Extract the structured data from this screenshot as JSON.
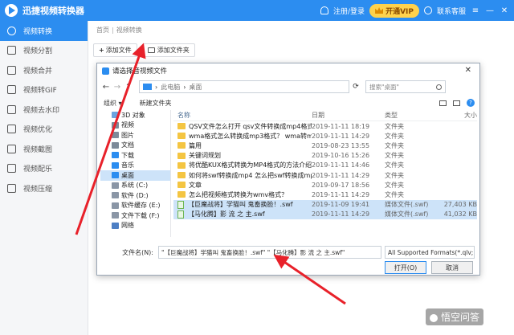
{
  "app": {
    "title": "迅捷视频转换器"
  },
  "titlebar": {
    "login": "注册/登录",
    "vip": "开通VIP",
    "support": "联系客服",
    "menu": "≡",
    "minimize": "—",
    "close": "✕"
  },
  "sidebar": {
    "items": [
      {
        "label": "视频转换",
        "active": true
      },
      {
        "label": "视频分割"
      },
      {
        "label": "视频合并"
      },
      {
        "label": "视频转GIF"
      },
      {
        "label": "视频去水印"
      },
      {
        "label": "视频优化"
      },
      {
        "label": "视频截图"
      },
      {
        "label": "视频配乐"
      },
      {
        "label": "视频压缩"
      }
    ]
  },
  "breadcrumb": {
    "home": "首页",
    "sep": "|",
    "current": "视频转换"
  },
  "toolbar": {
    "add_file": "添加文件",
    "add_folder": "添加文件夹",
    "plus": "+"
  },
  "dialog": {
    "title": "请选择音视频文件",
    "close": "✕",
    "back": "←",
    "forward": "→",
    "up": "↑",
    "path_pc": "此电脑",
    "path_sep": "›",
    "path_desktop": "桌面",
    "refresh": "⟳",
    "search_placeholder": "搜索\"桌面\"",
    "organize": "组织 ▾",
    "new_folder": "新建文件夹",
    "help": "?",
    "nav": [
      {
        "label": "3D 对象",
        "color": "#6aa4e0"
      },
      {
        "label": "视频",
        "color": "#7d8a99"
      },
      {
        "label": "图片",
        "color": "#7d8a99"
      },
      {
        "label": "文档",
        "color": "#7d8a99"
      },
      {
        "label": "下载",
        "color": "#2c8df0"
      },
      {
        "label": "音乐",
        "color": "#2c8df0"
      },
      {
        "label": "桌面",
        "color": "#2c8df0",
        "selected": true
      },
      {
        "label": "系统 (C:)",
        "color": "#8a96a6"
      },
      {
        "label": "软件 (D:)",
        "color": "#8a96a6"
      },
      {
        "label": "软件缓存 (E:)",
        "color": "#8a96a6"
      },
      {
        "label": "文件下载 (F:)",
        "color": "#8a96a6"
      },
      {
        "label": "网络",
        "color": "#4d7fc4"
      }
    ],
    "columns": {
      "name": "名称",
      "date": "日期",
      "type": "类型",
      "size": "大小"
    },
    "sort_up": "^",
    "files": [
      {
        "name": "QSV文件怎么打开 qsv文件转换成mp4格式教...",
        "date": "2019-11-11 18:19",
        "type": "文件夹",
        "size": "",
        "kind": "folder"
      },
      {
        "name": "wma格式怎么转换成mp3格式？ wma转mp3视...",
        "date": "2019-11-11 14:29",
        "type": "文件夹",
        "size": "",
        "kind": "folder"
      },
      {
        "name": "篇用",
        "date": "2019-08-23 13:55",
        "type": "文件夹",
        "size": "",
        "kind": "folder"
      },
      {
        "name": "关键词规划",
        "date": "2019-10-16 15:26",
        "type": "文件夹",
        "size": "",
        "kind": "folder"
      },
      {
        "name": "将优酷KUX格式转换为MP4格式的方法介绍",
        "date": "2019-11-11 14:46",
        "type": "文件夹",
        "size": "",
        "kind": "folder"
      },
      {
        "name": "如何将swf转换成mp4 怎么把swf转换成mp4",
        "date": "2019-11-11 14:29",
        "type": "文件夹",
        "size": "",
        "kind": "folder"
      },
      {
        "name": "文章",
        "date": "2019-09-17 18:56",
        "type": "文件夹",
        "size": "",
        "kind": "folder"
      },
      {
        "name": "怎么把视频格式转换为wmv格式？",
        "date": "2019-11-11 14:29",
        "type": "文件夹",
        "size": "",
        "kind": "folder"
      },
      {
        "name": "【巨魔战将】学猫叫 鬼畜换脸！.swf",
        "date": "2019-11-09 19:41",
        "type": "媒体文件(.swf)",
        "size": "27,403 KB",
        "kind": "swf",
        "selected": true
      },
      {
        "name": "【马化腾】影 流 之 主.swf",
        "date": "2019-11-11 14:29",
        "type": "媒体文件(.swf)",
        "size": "41,032 KB",
        "kind": "swf",
        "selected": true
      }
    ],
    "filename_label": "文件名(N):",
    "filename_value": "\"【巨魔战将】学猫叫 鬼畜换脸！.swf\" \"【马化腾】影 流 之 主.swf\"",
    "format_value": "All Supported Formats(*.qlv;",
    "open": "打开(O)",
    "cancel": "取消"
  },
  "watermark": {
    "text": "悟空问答"
  },
  "colors": {
    "brand": "#2c8df0",
    "arrow": "#e8212a",
    "vip": "#ffd24c"
  }
}
